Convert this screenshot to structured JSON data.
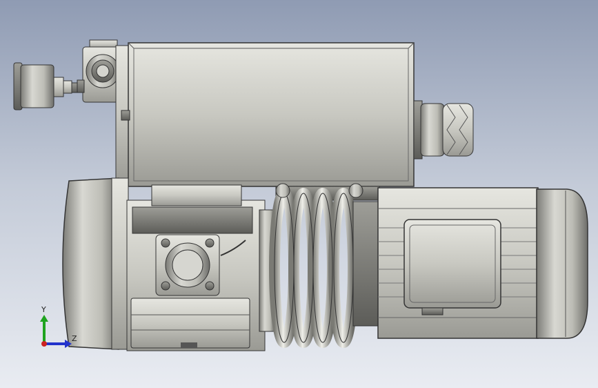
{
  "viewport": {
    "background_top": "#8f9bb3",
    "background_bottom": "#e9ecf2",
    "model_fill": "#c9c9c2",
    "model_edge": "#3a3a3a"
  },
  "model": {
    "components": [
      "vacuum-gauge",
      "valve-block",
      "exhaust-filter-housing",
      "inlet-filter-cap",
      "pump-end-cover",
      "pump-body",
      "inlet-flange",
      "cooling-coil",
      "motor-body",
      "terminal-box",
      "motor-fan-cover"
    ]
  },
  "triad": {
    "y_label": "Y",
    "z_label": "Z",
    "y_color": "#1fa31f",
    "z_color": "#2233cc",
    "origin_color": "#cc2222"
  }
}
